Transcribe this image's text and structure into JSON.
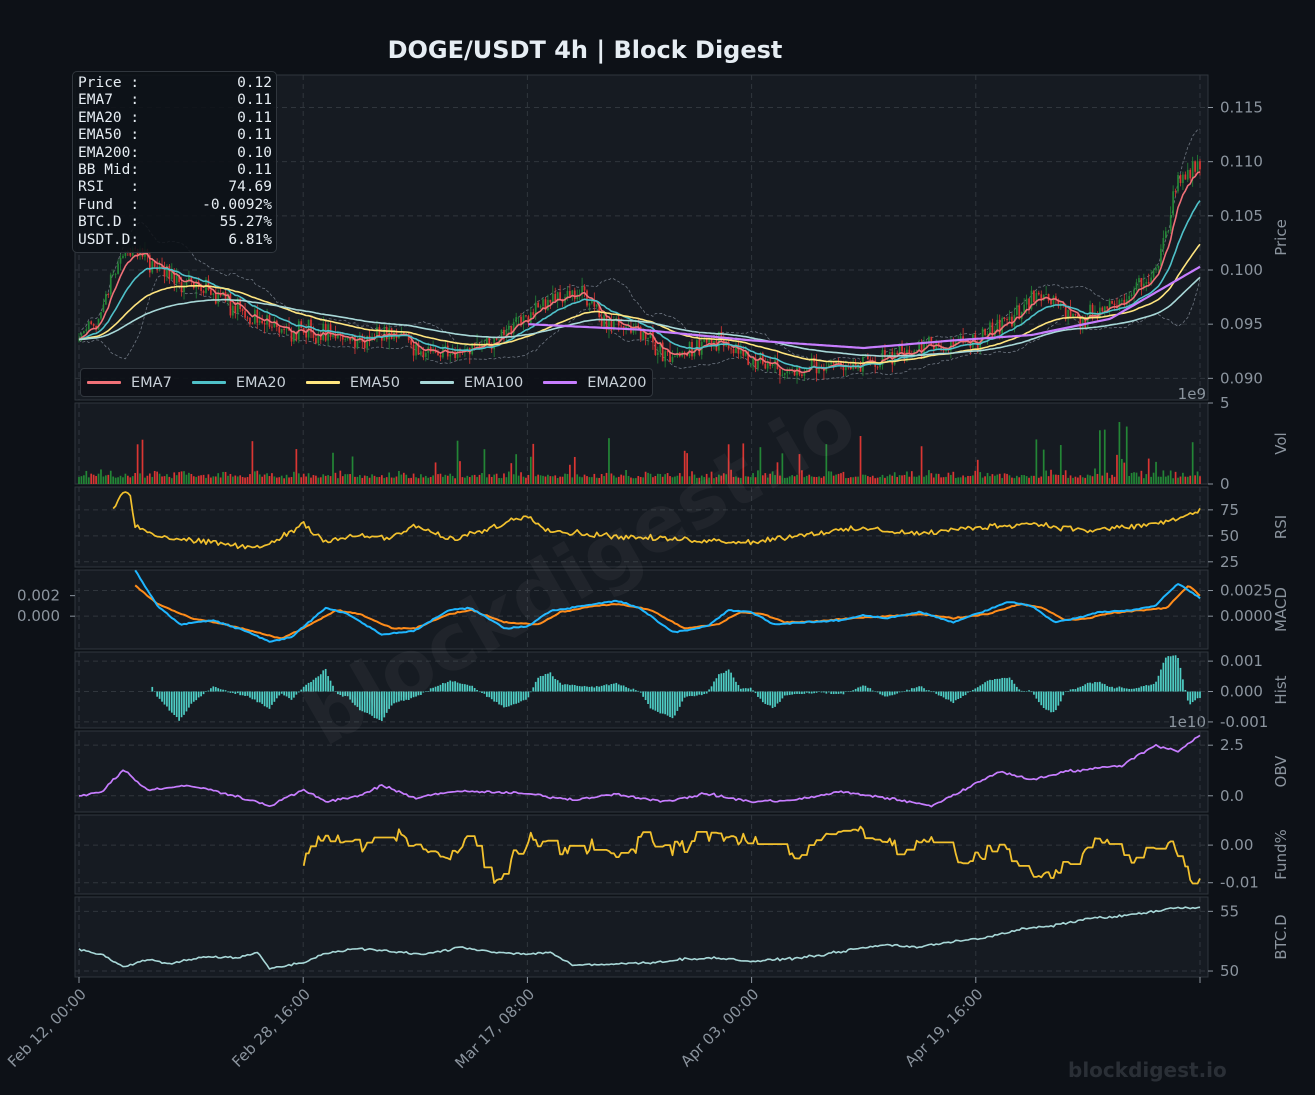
{
  "title": "DOGE/USDT  4h  |  Block Digest",
  "watermark": "blockdigest.io",
  "watermark_small": "blockdigest.io",
  "infobox": [
    {
      "label": "Price :",
      "value": "0.12"
    },
    {
      "label": "EMA7  :",
      "value": "0.11"
    },
    {
      "label": "EMA20 :",
      "value": "0.11"
    },
    {
      "label": "EMA50 :",
      "value": "0.11"
    },
    {
      "label": "EMA200:",
      "value": "0.10"
    },
    {
      "label": "BB Mid:",
      "value": "0.11"
    },
    {
      "label": "RSI   :",
      "value": "74.69"
    },
    {
      "label": "Fund  :",
      "value": "-0.0092%"
    },
    {
      "label": "BTC.D :",
      "value": "55.27%"
    },
    {
      "label": "USDT.D:",
      "value": "6.81%"
    }
  ],
  "colors": {
    "background": "#0d1117",
    "panel": "#161b22",
    "grid": "#30363d",
    "up": "#238636",
    "down": "#da3633",
    "ema7": "#f07178",
    "ema20": "#4fc1c9",
    "ema50": "#ffe57f",
    "ema100": "#a8d8d8",
    "ema200": "#c77dff",
    "rsi": "#f2c12e",
    "macd": "#1fb6ff",
    "signal": "#ff8c1a",
    "hist": "#4ecdc4",
    "obv": "#c77dff",
    "fund": "#f2c12e",
    "btcd": "#a8d8d8"
  },
  "chart_data": {
    "type": "line",
    "x_ticks": [
      "Feb 12, 00:00",
      "Feb 28, 16:00",
      "Mar 17, 08:00",
      "Apr 03, 00:00",
      "Apr 19, 16:00"
    ],
    "legend": [
      "EMA7",
      "EMA20",
      "EMA50",
      "EMA100",
      "EMA200"
    ],
    "legend_position": "lower-left",
    "grid": true,
    "panels": [
      {
        "name": "price",
        "ylabel": "Price",
        "ylim": [
          0.088,
          0.118
        ],
        "ticks": [
          "0.090",
          "0.095",
          "0.100",
          "0.105",
          "0.110",
          "0.115"
        ],
        "tick_values": [
          0.09,
          0.095,
          0.1,
          0.105,
          0.11,
          0.115
        ],
        "ema200_keypoints": [
          [
            0.4,
            0.095
          ],
          [
            0.5,
            0.0945
          ],
          [
            0.6,
            0.0935
          ],
          [
            0.7,
            0.0928
          ],
          [
            0.78,
            0.0935
          ],
          [
            0.85,
            0.094
          ],
          [
            0.92,
            0.0955
          ],
          [
            1.0,
            0.1003
          ]
        ],
        "price_keypoints": [
          [
            0.0,
            0.0935
          ],
          [
            0.02,
            0.096
          ],
          [
            0.04,
            0.102
          ],
          [
            0.06,
            0.101
          ],
          [
            0.08,
            0.0995
          ],
          [
            0.12,
            0.098
          ],
          [
            0.15,
            0.0955
          ],
          [
            0.18,
            0.095
          ],
          [
            0.22,
            0.094
          ],
          [
            0.25,
            0.0935
          ],
          [
            0.28,
            0.0945
          ],
          [
            0.31,
            0.0925
          ],
          [
            0.35,
            0.0925
          ],
          [
            0.38,
            0.0945
          ],
          [
            0.42,
            0.0975
          ],
          [
            0.45,
            0.098
          ],
          [
            0.47,
            0.0955
          ],
          [
            0.5,
            0.0945
          ],
          [
            0.53,
            0.092
          ],
          [
            0.57,
            0.0935
          ],
          [
            0.6,
            0.0915
          ],
          [
            0.64,
            0.0905
          ],
          [
            0.68,
            0.091
          ],
          [
            0.72,
            0.092
          ],
          [
            0.76,
            0.093
          ],
          [
            0.8,
            0.0935
          ],
          [
            0.83,
            0.0955
          ],
          [
            0.86,
            0.098
          ],
          [
            0.88,
            0.096
          ],
          [
            0.9,
            0.0955
          ],
          [
            0.93,
            0.0975
          ],
          [
            0.96,
            0.0995
          ],
          [
            0.98,
            0.108
          ],
          [
            1.0,
            0.11
          ],
          [
            1.02,
            0.115
          ]
        ],
        "ema_keypoints_note": "x as fraction of the time axis"
      },
      {
        "name": "vol",
        "ylabel": "Vol",
        "multiplier": "1e9",
        "ylim": [
          0,
          5
        ],
        "ticks": [
          "0",
          "5"
        ],
        "tick_values": [
          0,
          5
        ]
      },
      {
        "name": "rsi",
        "ylabel": "RSI",
        "ylim": [
          20,
          97
        ],
        "ticks": [
          "25",
          "50",
          "75"
        ],
        "tick_values": [
          25,
          50,
          75
        ],
        "keypoints": [
          [
            0.03,
            75
          ],
          [
            0.035,
            85
          ],
          [
            0.04,
            92
          ],
          [
            0.045,
            93
          ],
          [
            0.05,
            60
          ],
          [
            0.07,
            50
          ],
          [
            0.1,
            45
          ],
          [
            0.13,
            42
          ],
          [
            0.16,
            38
          ],
          [
            0.18,
            48
          ],
          [
            0.2,
            62
          ],
          [
            0.22,
            45
          ],
          [
            0.25,
            50
          ],
          [
            0.28,
            48
          ],
          [
            0.3,
            60
          ],
          [
            0.33,
            46
          ],
          [
            0.36,
            55
          ],
          [
            0.4,
            70
          ],
          [
            0.42,
            55
          ],
          [
            0.45,
            52
          ],
          [
            0.5,
            48
          ],
          [
            0.55,
            46
          ],
          [
            0.6,
            44
          ],
          [
            0.65,
            52
          ],
          [
            0.7,
            57
          ],
          [
            0.75,
            52
          ],
          [
            0.8,
            58
          ],
          [
            0.85,
            62
          ],
          [
            0.9,
            55
          ],
          [
            0.95,
            60
          ],
          [
            0.98,
            66
          ],
          [
            1.0,
            74.69
          ]
        ]
      },
      {
        "name": "macd",
        "ylabel": "MACD",
        "ylim": [
          -0.0032,
          0.0045
        ],
        "ticks": [
          "0.0000",
          "0.0025"
        ],
        "tick_values": [
          0,
          0.0025
        ],
        "left_ticks": [
          "0.000",
          "0.002"
        ],
        "left_tick_values": [
          0,
          0.002
        ],
        "macd_keypoints": [
          [
            0.05,
            0.0045
          ],
          [
            0.07,
            0.001
          ],
          [
            0.09,
            -0.0008
          ],
          [
            0.12,
            -0.0004
          ],
          [
            0.15,
            -0.0015
          ],
          [
            0.17,
            -0.0025
          ],
          [
            0.19,
            -0.002
          ],
          [
            0.22,
            0.0008
          ],
          [
            0.24,
            0.0002
          ],
          [
            0.27,
            -0.0018
          ],
          [
            0.3,
            -0.0014
          ],
          [
            0.33,
            0.0006
          ],
          [
            0.35,
            0.0008
          ],
          [
            0.38,
            -0.0012
          ],
          [
            0.4,
            -0.001
          ],
          [
            0.42,
            0.0005
          ],
          [
            0.45,
            0.001
          ],
          [
            0.48,
            0.0015
          ],
          [
            0.5,
            0.0008
          ],
          [
            0.53,
            -0.0016
          ],
          [
            0.56,
            -0.001
          ],
          [
            0.58,
            0.0006
          ],
          [
            0.6,
            0.0004
          ],
          [
            0.62,
            -0.0008
          ],
          [
            0.65,
            -0.0006
          ],
          [
            0.68,
            -0.0004
          ],
          [
            0.7,
            0.0001
          ],
          [
            0.72,
            -0.0002
          ],
          [
            0.75,
            0.0004
          ],
          [
            0.78,
            -0.0006
          ],
          [
            0.8,
            0.0002
          ],
          [
            0.83,
            0.0014
          ],
          [
            0.85,
            0.001
          ],
          [
            0.87,
            -0.0006
          ],
          [
            0.89,
            -0.0002
          ],
          [
            0.91,
            0.0004
          ],
          [
            0.94,
            0.0006
          ],
          [
            0.96,
            0.001
          ],
          [
            0.98,
            0.0032
          ],
          [
            1.0,
            0.0018
          ]
        ],
        "signal_keypoints": [
          [
            0.05,
            0.003
          ],
          [
            0.07,
            0.0012
          ],
          [
            0.1,
            -0.0002
          ],
          [
            0.13,
            -0.0008
          ],
          [
            0.16,
            -0.0016
          ],
          [
            0.18,
            -0.0022
          ],
          [
            0.2,
            -0.0012
          ],
          [
            0.23,
            0.0006
          ],
          [
            0.25,
            0.0002
          ],
          [
            0.28,
            -0.0012
          ],
          [
            0.3,
            -0.0012
          ],
          [
            0.33,
            0.0002
          ],
          [
            0.35,
            0.0006
          ],
          [
            0.38,
            -0.0006
          ],
          [
            0.41,
            -0.0008
          ],
          [
            0.43,
            0.0004
          ],
          [
            0.46,
            0.001
          ],
          [
            0.48,
            0.0012
          ],
          [
            0.51,
            0.0006
          ],
          [
            0.54,
            -0.0012
          ],
          [
            0.57,
            -0.0008
          ],
          [
            0.59,
            0.0004
          ],
          [
            0.61,
            0.0002
          ],
          [
            0.63,
            -0.0006
          ],
          [
            0.66,
            -0.0005
          ],
          [
            0.69,
            -0.0002
          ],
          [
            0.72,
            0.0
          ],
          [
            0.75,
            0.0002
          ],
          [
            0.78,
            -0.0002
          ],
          [
            0.81,
            0.0002
          ],
          [
            0.84,
            0.0012
          ],
          [
            0.86,
            0.0008
          ],
          [
            0.88,
            -0.0004
          ],
          [
            0.9,
            -0.0002
          ],
          [
            0.92,
            0.0003
          ],
          [
            0.95,
            0.0006
          ],
          [
            0.97,
            0.0008
          ],
          [
            0.99,
            0.003
          ],
          [
            1.0,
            0.002
          ]
        ]
      },
      {
        "name": "hist",
        "ylabel": "Hist",
        "ylim": [
          -0.0012,
          0.0013
        ],
        "ticks": [
          "-0.001",
          "0.000",
          "0.001"
        ],
        "tick_values": [
          -0.001,
          0,
          0.001
        ]
      },
      {
        "name": "obv",
        "ylabel": "OBV",
        "multiplier": "1e10",
        "ylim": [
          -0.8,
          3.2
        ],
        "ticks": [
          "0.0",
          "2.5"
        ],
        "tick_values": [
          0,
          2.5
        ],
        "keypoints": [
          [
            0.0,
            0.0
          ],
          [
            0.02,
            0.2
          ],
          [
            0.04,
            1.3
          ],
          [
            0.06,
            0.3
          ],
          [
            0.1,
            0.5
          ],
          [
            0.14,
            0.0
          ],
          [
            0.17,
            -0.5
          ],
          [
            0.2,
            0.3
          ],
          [
            0.22,
            -0.3
          ],
          [
            0.25,
            0.0
          ],
          [
            0.27,
            0.5
          ],
          [
            0.3,
            -0.1
          ],
          [
            0.33,
            0.2
          ],
          [
            0.36,
            0.2
          ],
          [
            0.4,
            0.1
          ],
          [
            0.44,
            -0.2
          ],
          [
            0.48,
            0.1
          ],
          [
            0.52,
            -0.3
          ],
          [
            0.56,
            0.1
          ],
          [
            0.6,
            -0.3
          ],
          [
            0.64,
            -0.2
          ],
          [
            0.68,
            0.2
          ],
          [
            0.72,
            -0.1
          ],
          [
            0.76,
            -0.5
          ],
          [
            0.79,
            0.3
          ],
          [
            0.82,
            1.2
          ],
          [
            0.85,
            0.8
          ],
          [
            0.88,
            1.2
          ],
          [
            0.9,
            1.3
          ],
          [
            0.93,
            1.5
          ],
          [
            0.96,
            2.5
          ],
          [
            0.98,
            2.2
          ],
          [
            1.0,
            3.0
          ]
        ]
      },
      {
        "name": "fund",
        "ylabel": "Fund%",
        "ylim": [
          -0.013,
          0.008
        ],
        "ticks": [
          "-0.01",
          "0.00"
        ],
        "tick_values": [
          -0.01,
          0
        ],
        "keypoints": [
          [
            0.2,
            -0.004
          ],
          [
            0.22,
            0.003
          ],
          [
            0.25,
            -0.001
          ],
          [
            0.28,
            0.004
          ],
          [
            0.3,
            0.0
          ],
          [
            0.33,
            -0.004
          ],
          [
            0.35,
            0.003
          ],
          [
            0.37,
            -0.01
          ],
          [
            0.4,
            0.001
          ],
          [
            0.43,
            -0.001
          ],
          [
            0.45,
            0.001
          ],
          [
            0.48,
            -0.004
          ],
          [
            0.5,
            0.001
          ],
          [
            0.53,
            -0.001
          ],
          [
            0.56,
            0.003
          ],
          [
            0.6,
            0.001
          ],
          [
            0.63,
            -0.003
          ],
          [
            0.66,
            0.002
          ],
          [
            0.7,
            0.004
          ],
          [
            0.73,
            -0.001
          ],
          [
            0.76,
            0.002
          ],
          [
            0.79,
            -0.005
          ],
          [
            0.82,
            0.001
          ],
          [
            0.85,
            -0.009
          ],
          [
            0.88,
            -0.006
          ],
          [
            0.91,
            0.002
          ],
          [
            0.94,
            -0.005
          ],
          [
            0.97,
            0.003
          ],
          [
            0.99,
            -0.009
          ],
          [
            1.0,
            -0.0092
          ]
        ]
      },
      {
        "name": "btcd",
        "ylabel": "BTC.D",
        "ylim": [
          49.5,
          56.2
        ],
        "ticks": [
          "50",
          "55"
        ],
        "tick_values": [
          50,
          55
        ],
        "keypoints": [
          [
            0.0,
            51.8
          ],
          [
            0.02,
            51.4
          ],
          [
            0.04,
            50.3
          ],
          [
            0.06,
            51.0
          ],
          [
            0.08,
            50.6
          ],
          [
            0.11,
            51.2
          ],
          [
            0.14,
            51.1
          ],
          [
            0.16,
            51.5
          ],
          [
            0.17,
            50.2
          ],
          [
            0.2,
            50.7
          ],
          [
            0.22,
            51.5
          ],
          [
            0.25,
            51.9
          ],
          [
            0.28,
            51.6
          ],
          [
            0.31,
            51.4
          ],
          [
            0.34,
            52.0
          ],
          [
            0.37,
            51.6
          ],
          [
            0.4,
            51.4
          ],
          [
            0.42,
            51.6
          ],
          [
            0.44,
            50.5
          ],
          [
            0.46,
            50.5
          ],
          [
            0.48,
            50.6
          ],
          [
            0.51,
            50.7
          ],
          [
            0.54,
            51.0
          ],
          [
            0.57,
            51.1
          ],
          [
            0.6,
            50.8
          ],
          [
            0.63,
            51.0
          ],
          [
            0.66,
            51.3
          ],
          [
            0.69,
            51.8
          ],
          [
            0.72,
            52.2
          ],
          [
            0.75,
            52.0
          ],
          [
            0.78,
            52.5
          ],
          [
            0.81,
            52.8
          ],
          [
            0.84,
            53.5
          ],
          [
            0.87,
            53.8
          ],
          [
            0.9,
            54.4
          ],
          [
            0.93,
            54.6
          ],
          [
            0.96,
            55.0
          ],
          [
            0.98,
            55.3
          ],
          [
            1.0,
            55.27
          ]
        ]
      }
    ]
  }
}
